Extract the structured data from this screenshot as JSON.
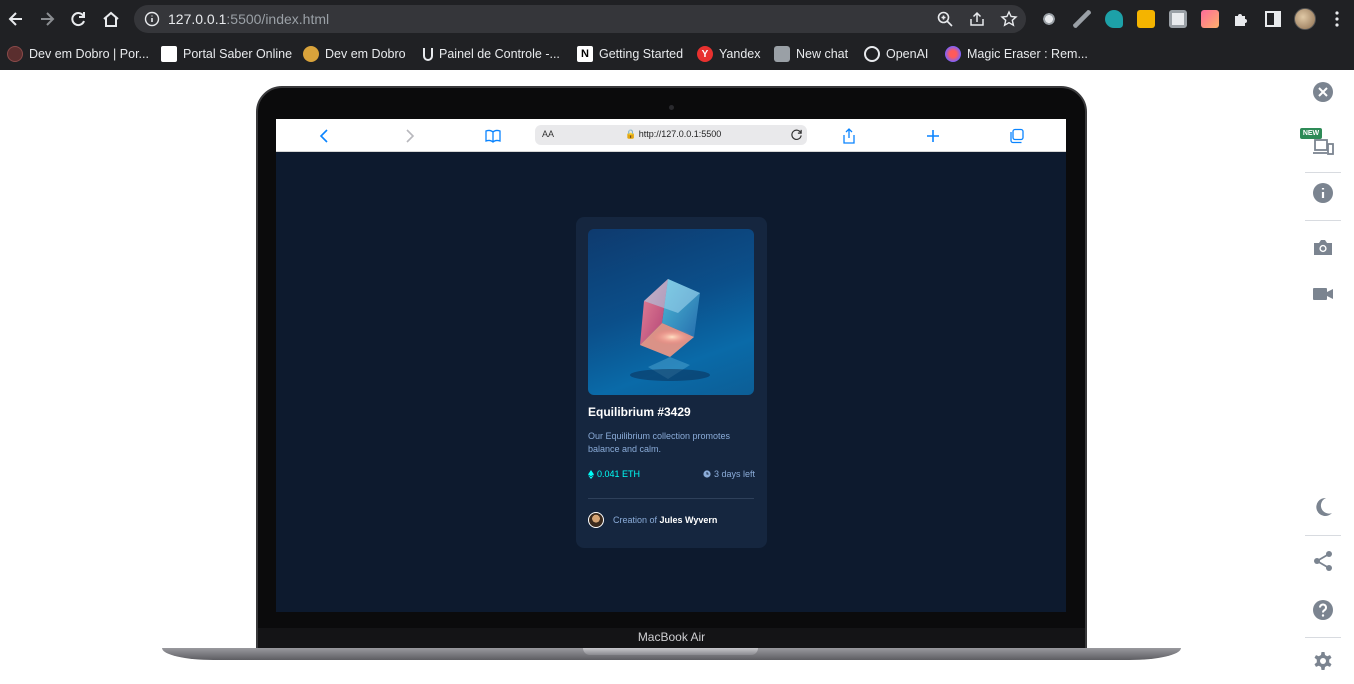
{
  "browser": {
    "url_host": "127.0.0.1",
    "url_rest": ":5500/index.html",
    "bookmarks": [
      {
        "label": "Dev em Dobro | Por...",
        "icon": "dev-em-dobro-icon",
        "color": "#5a2e2e"
      },
      {
        "label": "Portal Saber Online",
        "icon": "portal-saber-icon",
        "color": "#ffffff"
      },
      {
        "label": "Dev em Dobro",
        "icon": "dev-em-dobro-coin-icon",
        "color": "#d9a33b"
      },
      {
        "label": "Painel de Controle -...",
        "icon": "painel-icon",
        "color": "#202124"
      },
      {
        "label": "Getting Started",
        "icon": "notion-icon",
        "color": "#ffffff"
      },
      {
        "label": "Yandex",
        "icon": "yandex-icon",
        "color": "#e8312f"
      },
      {
        "label": "New chat",
        "icon": "chatgpt-icon",
        "color": "#9aa0a6"
      },
      {
        "label": "OpenAI",
        "icon": "openai-icon",
        "color": "#ffffff"
      },
      {
        "label": "Magic Eraser : Rem...",
        "icon": "magic-eraser-icon",
        "color": "#7b61ff"
      }
    ]
  },
  "device": {
    "label": "MacBook Air",
    "safari_aa": "AA",
    "safari_url": "http://127.0.0.1:5500"
  },
  "card": {
    "title": "Equilibrium #3429",
    "description": "Our Equilibrium collection promotes balance and calm.",
    "price": "0.041 ETH",
    "time_left": "3 days left",
    "creator_prefix": "Creation of",
    "creator_name": "Jules Wyvern"
  },
  "panel": {
    "new_badge": "NEW"
  },
  "colors": {
    "page_bg": "#0d1a2e",
    "card_bg": "#15263f",
    "accent_cyan": "#00fff8",
    "soft_blue": "#8bacd9"
  }
}
